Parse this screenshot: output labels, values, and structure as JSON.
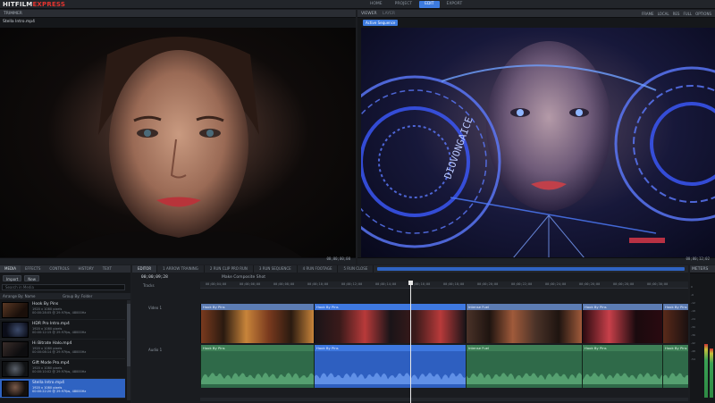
{
  "app": {
    "logo_main": "HITFILM",
    "logo_accent": "EXPRESS"
  },
  "topnav": [
    "HOME",
    "PROJECT",
    "EDIT",
    "EXPORT"
  ],
  "topnav_active": "EDIT",
  "trimmer": {
    "title": "TRIMMER",
    "file": "Stella Intro.mp4",
    "timecode": "00;00;00;00"
  },
  "viewer": {
    "tabs": [
      "VIEWER",
      "LAYER"
    ],
    "tag": "Active Sequence",
    "tools": [
      "FRAME",
      "LOCAL",
      "RES",
      "FULL",
      "OPTIONS"
    ],
    "overlay_text": "DIOVONGAICE",
    "timecode": "00;00;12;02"
  },
  "media": {
    "tabs": [
      "MEDIA",
      "EFFECTS",
      "CONTROLS",
      "HISTORY",
      "TEXT"
    ],
    "import_label": "Import",
    "new_label": "New",
    "search_placeholder": "Search in Media",
    "col_arrange": "Arrange By: Name",
    "col_group": "Group By: Folder",
    "items": [
      {
        "name": "Hook By Pins",
        "meta": "1920 x 1080 pixels\n00:00:28:05 @ 29.97fps, 48000Hz"
      },
      {
        "name": "HDR Pro Intro.mp4",
        "meta": "1920 x 1080 pixels\n00:00:12:15 @ 29.97fps, 48000Hz"
      },
      {
        "name": "Hi Bitrate Halo.mp4",
        "meta": "1920 x 1080 pixels\n00:00:08:14 @ 29.97fps, 48000Hz"
      },
      {
        "name": "Gift Mode Pro.mp4",
        "meta": "1920 x 1080 pixels\n00:00:10:02 @ 29.97fps, 48000Hz"
      },
      {
        "name": "Stella Intro.mp4",
        "meta": "1920 x 1080 pixels\n00:00:22:20 @ 29.97fps, 48000Hz"
      }
    ],
    "selected_index": 4
  },
  "editor": {
    "tabs": [
      "EDITOR",
      "1 ARROW TRAINING",
      "2 RUN CLIP PRO RUN",
      "3 RUN SEQUENCE",
      "4 RUN FOOTAGE",
      "5 RUN CLOSE"
    ],
    "timecode": "00;00;09;28",
    "comp_label": "Make Composite Shot",
    "tracks_label": "Tracks",
    "video_track": "Video 1",
    "audio_track": "Audio 1",
    "ruler": [
      "00;00;04;00",
      "00;00;06;00",
      "00;00;08;00",
      "00;00;10;00",
      "00;00;12;00",
      "00;00;14;00",
      "00;00;16;00",
      "00;00;18;00",
      "00;00;20;00",
      "00;00;22;00",
      "00;00;24;00",
      "00;00;26;00",
      "00;00;28;00",
      "00;00;30;00"
    ],
    "video_clips": [
      {
        "label": "Hook By Pins",
        "selected": false
      },
      {
        "label": "Hook By Pins",
        "selected": true
      },
      {
        "label": "Intense Fuel",
        "selected": false
      },
      {
        "label": "Hook By Pins",
        "selected": false
      },
      {
        "label": "Hook By Pins",
        "selected": false
      }
    ],
    "audio_clips": [
      {
        "label": "Hook By Pins",
        "selected": false
      },
      {
        "label": "Hook By Pins",
        "selected": true
      },
      {
        "label": "Intense Fuel",
        "selected": false
      },
      {
        "label": "Hook By Pins",
        "selected": false
      },
      {
        "label": "Hook By Pins",
        "selected": false
      }
    ]
  },
  "meters": {
    "title": "METERS",
    "ticks": [
      "0",
      "-6",
      "-12",
      "-18",
      "-24",
      "-30",
      "-36",
      "-42",
      "-48",
      "-54"
    ]
  },
  "colors": {
    "accent": "#3d7be0",
    "audio_clip": "#2f6a49",
    "logo_accent": "#e3342f"
  }
}
